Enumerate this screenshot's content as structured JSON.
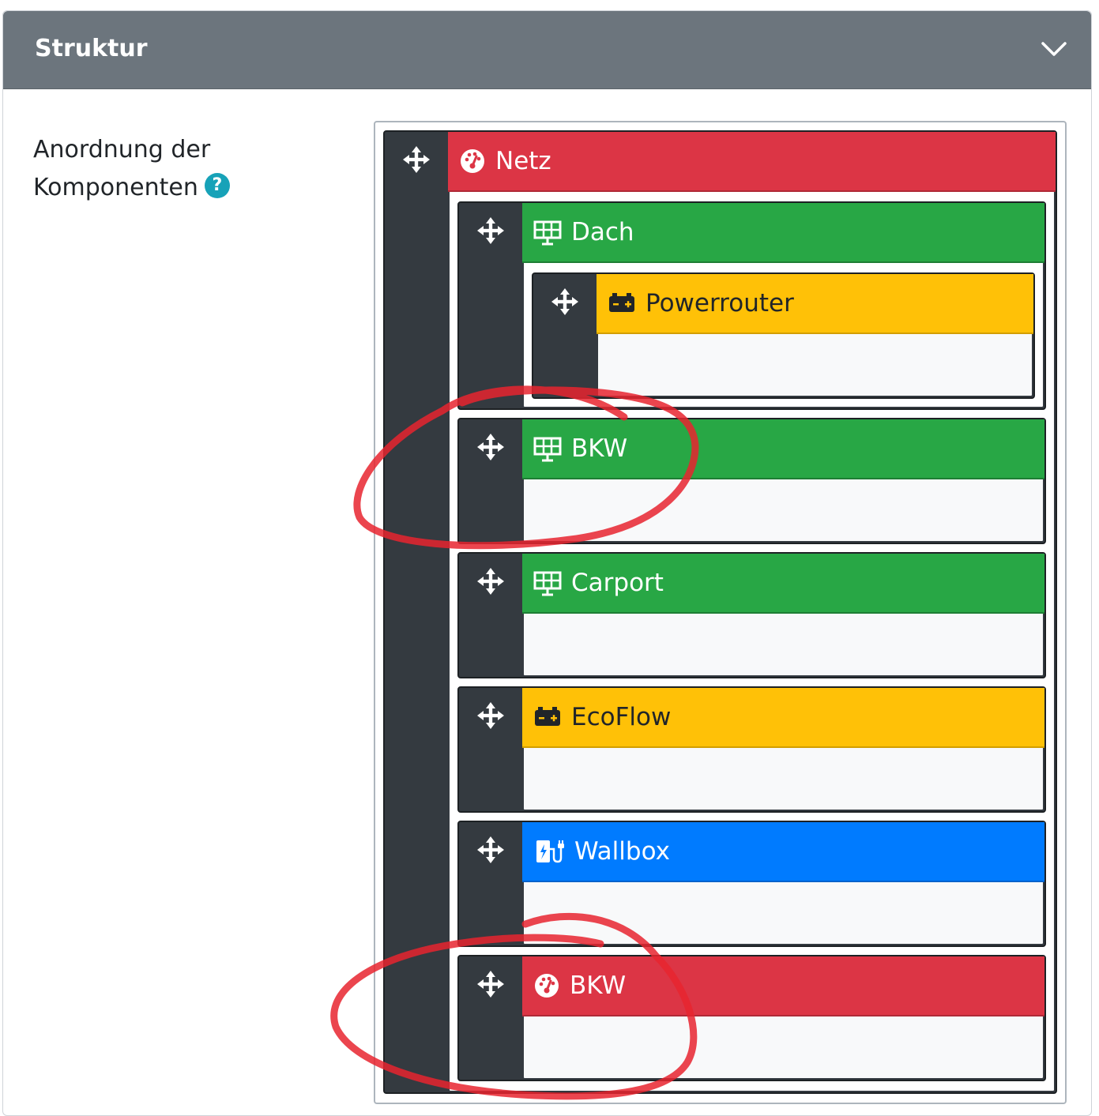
{
  "header": {
    "title": "Struktur"
  },
  "field": {
    "label_line1": "Anordnung der",
    "label_line2": "Komponenten",
    "help_symbol": "?"
  },
  "tree": {
    "root": {
      "name": "Netz",
      "color": "#dc3545",
      "icon": "meter-icon"
    },
    "children": [
      {
        "name": "Dach",
        "color": "#28a745",
        "icon": "solar-panel-icon",
        "children": [
          {
            "name": "Powerrouter",
            "color": "#ffc107",
            "icon": "battery-icon"
          }
        ]
      },
      {
        "name": "BKW",
        "color": "#28a745",
        "icon": "solar-panel-icon"
      },
      {
        "name": "Carport",
        "color": "#28a745",
        "icon": "solar-panel-icon"
      },
      {
        "name": "EcoFlow",
        "color": "#ffc107",
        "icon": "battery-icon"
      },
      {
        "name": "Wallbox",
        "color": "#007bff",
        "icon": "charging-station-icon"
      },
      {
        "name": "BKW",
        "color": "#dc3545",
        "icon": "meter-icon"
      }
    ]
  },
  "annotations": {
    "color": "#e8242f",
    "circled_items": [
      "BKW",
      "BKW"
    ]
  }
}
